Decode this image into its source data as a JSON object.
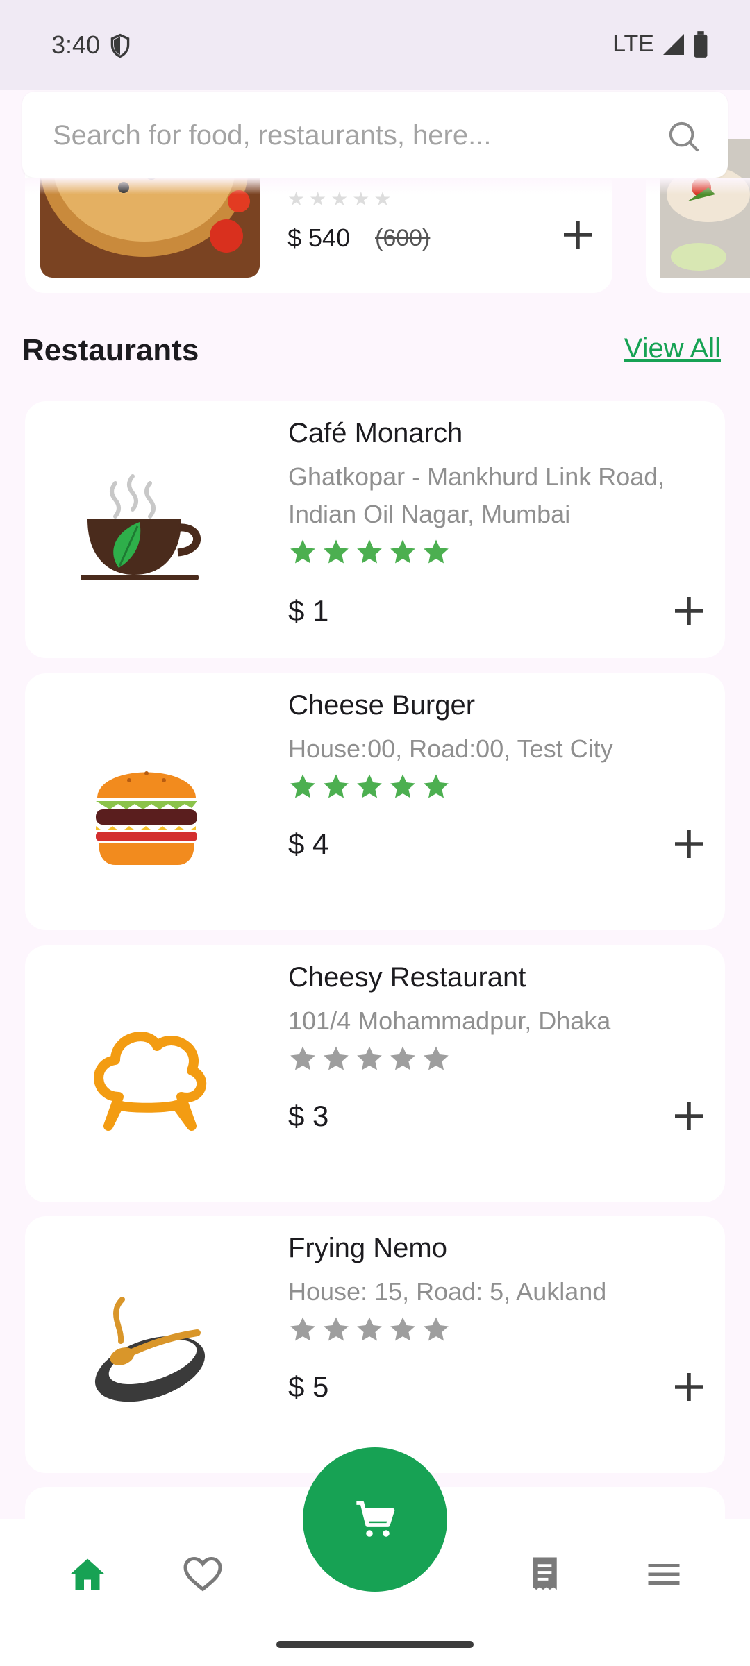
{
  "status_bar": {
    "time": "3:40",
    "network": "LTE"
  },
  "search": {
    "placeholder": "Search for food, restaurants, here..."
  },
  "top_item": {
    "price": "$ 540",
    "old_price": "(600)"
  },
  "section": {
    "title": "Restaurants",
    "view_all": "View All"
  },
  "restaurants": [
    {
      "name": "Café Monarch",
      "address": "Ghatkopar - Mankhurd Link Road, Indian Oil Nagar, Mumbai",
      "price": "$ 1",
      "rating": 5
    },
    {
      "name": "Cheese Burger",
      "address": "House:00, Road:00, Test City",
      "price": "$ 4",
      "rating": 5
    },
    {
      "name": "Cheesy Restaurant",
      "address": "101/4 Mohammadpur, Dhaka",
      "price": "$ 3",
      "rating": 0
    },
    {
      "name": "Frying Nemo",
      "address": "House: 15, Road: 5, Aukland",
      "price": "$ 5",
      "rating": 0
    }
  ],
  "colors": {
    "accent": "#17a254",
    "star_on": "#4caf50",
    "star_off": "#9e9e9e"
  },
  "icons": [
    "shield-icon",
    "signal-icon",
    "battery-icon",
    "search-icon",
    "plus-icon",
    "home-icon",
    "heart-icon",
    "cart-icon",
    "receipt-icon",
    "menu-icon"
  ]
}
